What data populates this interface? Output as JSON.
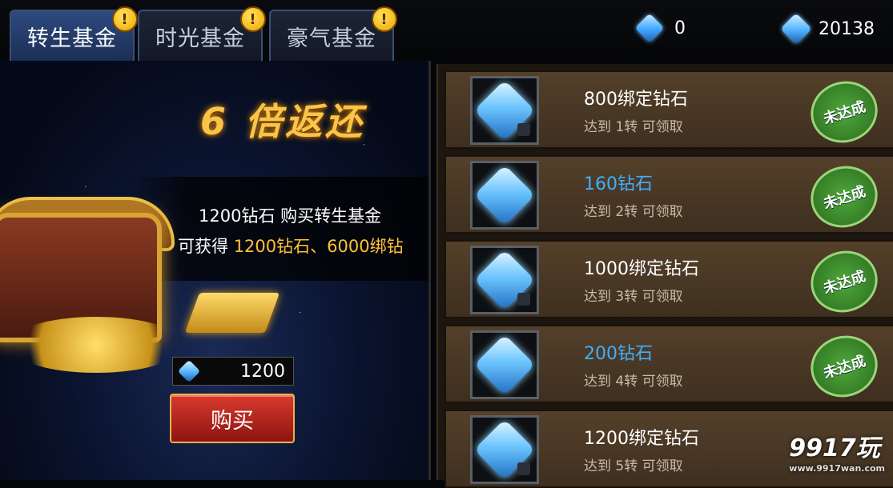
{
  "tabs": [
    {
      "label": "转生基金",
      "alert": "!"
    },
    {
      "label": "时光基金",
      "alert": "!"
    },
    {
      "label": "豪气基金",
      "alert": "!"
    }
  ],
  "currencies": {
    "diamond": "0",
    "bound_diamond": "20138"
  },
  "promo": {
    "headline": "6 倍返还",
    "line1": "1200钻石 购买转生基金",
    "line2_prefix": "可获得 ",
    "line2_highlight": "1200钻石、6000绑钻",
    "price": "1200",
    "buy_label": "购买"
  },
  "rewards": [
    {
      "title": "800绑定钻石",
      "condition": "达到 1转 可领取",
      "status": "未达成",
      "title_color": "white"
    },
    {
      "title": "160钻石",
      "condition": "达到 2转 可领取",
      "status": "未达成",
      "title_color": "blue"
    },
    {
      "title": "1000绑定钻石",
      "condition": "达到 3转 可领取",
      "status": "未达成",
      "title_color": "white"
    },
    {
      "title": "200钻石",
      "condition": "达到 4转 可领取",
      "status": "未达成",
      "title_color": "blue"
    },
    {
      "title": "1200绑定钻石",
      "condition": "达到 5转 可领取",
      "status": "",
      "title_color": "white"
    }
  ],
  "watermark": {
    "brand": "9917玩",
    "url": "www.9917wan.com"
  },
  "colors": {
    "accent_gold": "#ffc03a",
    "reward_blue": "#3fb0ff",
    "buy_red": "#c62a20",
    "stamp_green": "#3f8f2e"
  }
}
